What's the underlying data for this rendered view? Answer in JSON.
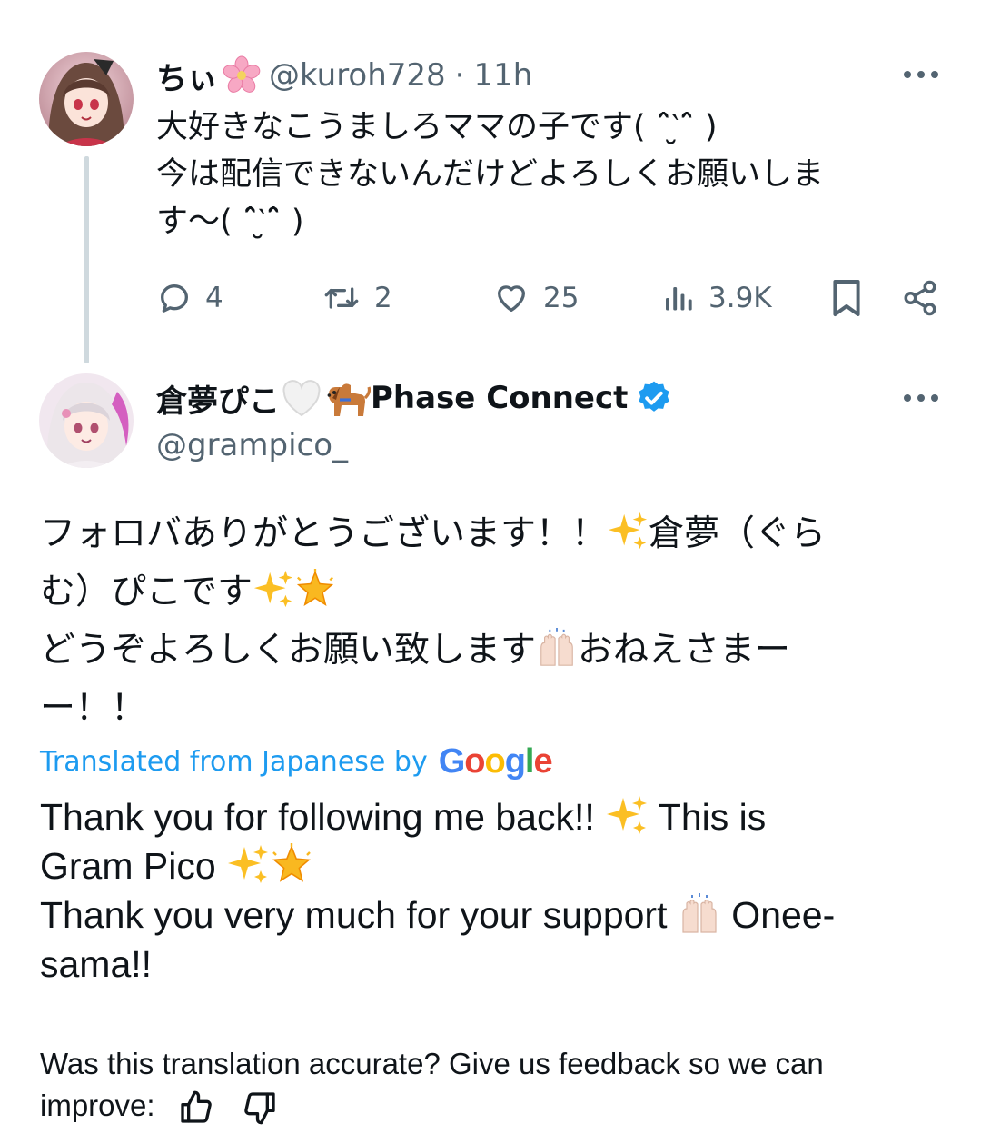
{
  "reply_tweet": {
    "author_name": "ちぃ",
    "handle": "@kuroh728",
    "separator": "·",
    "time": "11h",
    "text_lines": [
      "大好きなこうましろママの子です( ˆ̑‵̮ˆ̑ )",
      "今は配信できないんだけどよろしくお願いしま",
      "す〜( ˆ̑‵̮ˆ̑ )"
    ],
    "counts": {
      "replies": "4",
      "reposts": "2",
      "likes": "25",
      "views": "3.9K"
    },
    "icons": {
      "name_emoji": "cherry-blossom-icon",
      "reply": "speech-bubble-icon",
      "repost": "repost-arrows-icon",
      "like": "heart-icon",
      "views": "bar-chart-icon",
      "bookmark": "bookmark-icon",
      "share": "share-icon",
      "more": "more-dots-icon"
    }
  },
  "main_tweet": {
    "author_name": "倉夢ぴこ",
    "author_suffix": "Phase Connect",
    "handle": "@grampico_",
    "icons": {
      "heart_emoji": "white-heart-icon",
      "dog_emoji": "dog-icon",
      "verified": "verified-badge-icon",
      "sparkles": "sparkles-icon",
      "star": "glowing-star-icon",
      "hands": "raising-hands-icon"
    },
    "original_lines": [
      "フォロバありがとうございます！！",
      "倉夢（ぐら",
      "む）ぴこです",
      "どうぞよろしくお願い致します",
      "おねえさまー",
      "ー！！"
    ],
    "translated_by_label": "Translated from Japanese by",
    "google_letters": [
      "G",
      "o",
      "o",
      "g",
      "l",
      "e"
    ],
    "translation_lines": [
      "Thank you for following me back!!",
      "This is",
      "Gram Pico",
      "Thank you very much for your support",
      "Onee-",
      "sama!!"
    ],
    "feedback_line1": "Was this translation accurate? Give us feedback so we can",
    "feedback_line2": "improve:"
  },
  "colors": {
    "text": "#0f1419",
    "secondary": "#536471",
    "link": "#1d9bf0",
    "verified": "#1d9bf0",
    "thread_line": "#cfd9de",
    "google": [
      "#4285F4",
      "#EA4335",
      "#FBBC05",
      "#4285F4",
      "#34A853",
      "#EA4335"
    ]
  }
}
